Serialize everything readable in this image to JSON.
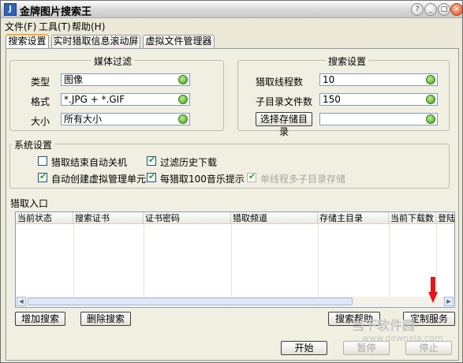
{
  "window": {
    "title": "金牌图片搜索王",
    "buttons": [
      "?",
      "_",
      "□",
      "×"
    ]
  },
  "menu": [
    "文件(F)",
    "工具(T)",
    "帮助(H)"
  ],
  "tabs": [
    "搜索设置",
    "实时猎取信息滚动屏",
    "虚拟文件管理器"
  ],
  "media_filter": {
    "legend": "媒体过滤",
    "type_label": "类型",
    "type_value": "图像",
    "format_label": "格式",
    "format_value": "*.JPG + *.GIF",
    "size_label": "大小",
    "size_value": "所有大小"
  },
  "search_settings": {
    "legend": "搜索设置",
    "threads_label": "猎取线程数",
    "threads_value": "10",
    "subdir_label": "子目录文件数",
    "subdir_value": "150",
    "choose_dir_button": "选择存储目录",
    "dir_value": ""
  },
  "system_settings": {
    "legend": "系统设置",
    "options": [
      {
        "label": "猎取结束自动关机",
        "checked": false,
        "enabled": true
      },
      {
        "label": "过滤历史下载",
        "checked": true,
        "enabled": true
      },
      {
        "label": "自动创建虚拟管理单元",
        "checked": true,
        "enabled": true
      },
      {
        "label": "每猎取100音乐提示",
        "checked": true,
        "enabled": true
      },
      {
        "label": "单线程多子目录存储",
        "checked": true,
        "enabled": false
      }
    ]
  },
  "entry": {
    "legend": "猎取入口",
    "columns": [
      "当前状态",
      "搜索证书",
      "证书密码",
      "猎取频道",
      "存储主目录",
      "当前下载数",
      "登陆时"
    ]
  },
  "buttons": {
    "add_search": "增加搜索",
    "delete_search": "删除搜索",
    "search_help": "搜索帮助",
    "custom_service": "定制服务",
    "start": "开始",
    "pause": "暂停",
    "stop": "停止"
  },
  "watermark": {
    "text": "当下软件园",
    "url": "www.downxia.com"
  },
  "colors": {
    "accent_tab": "#f5a93a",
    "indicator": "#4a9a1f",
    "arrow": "#e8141b"
  }
}
